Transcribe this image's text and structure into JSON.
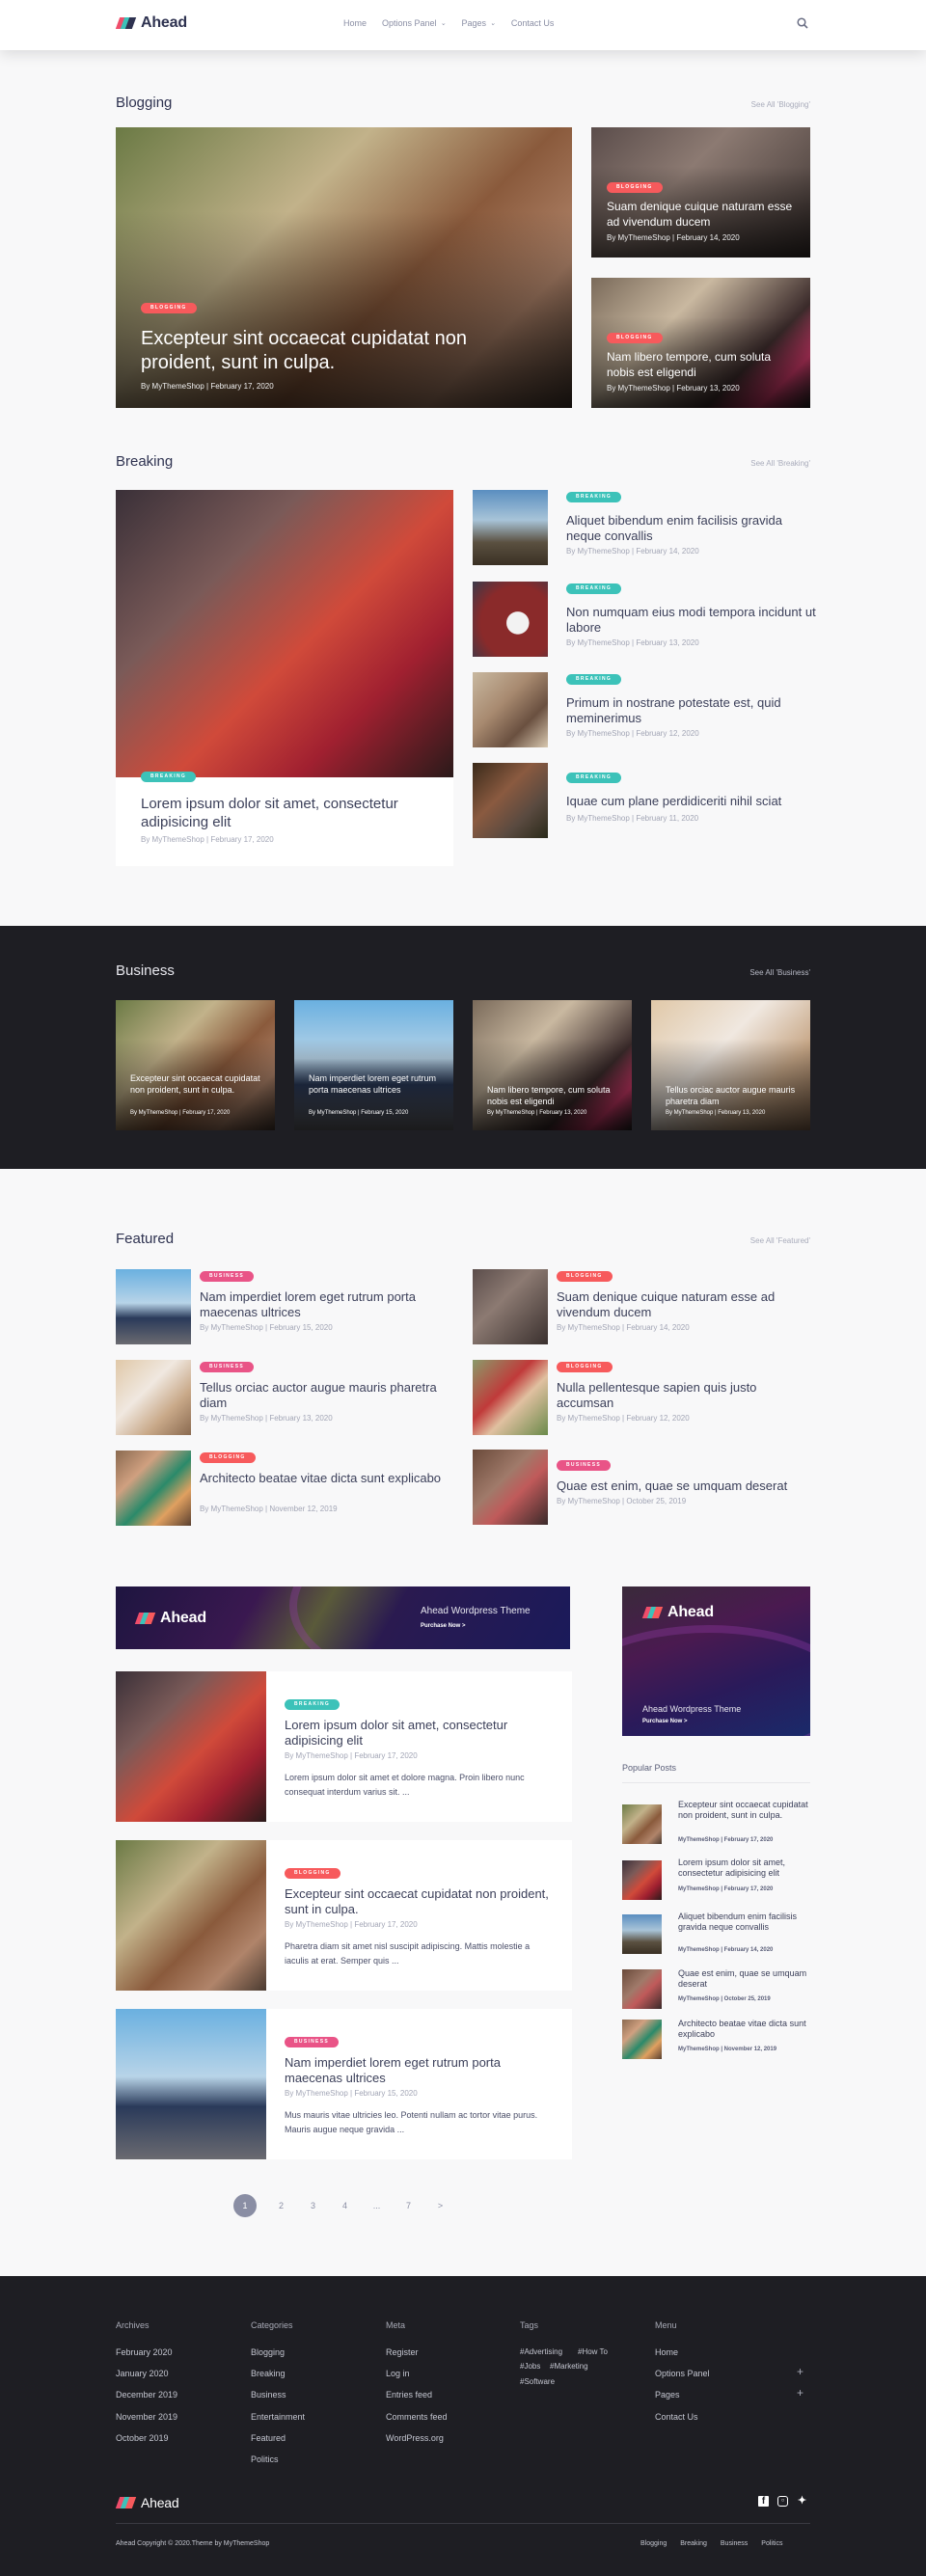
{
  "header": {
    "logo_text": "Ahead",
    "nav": [
      {
        "label": "Home",
        "has_dropdown": false
      },
      {
        "label": "Options Panel",
        "has_dropdown": true
      },
      {
        "label": "Pages",
        "has_dropdown": true
      },
      {
        "label": "Contact Us",
        "has_dropdown": false
      }
    ],
    "search_icon": "search-icon"
  },
  "colors": {
    "blogging": "#f75a5c",
    "breaking": "#3cc2b9",
    "business": "#e95487",
    "dark_bg": "#1e1e23",
    "text": "#2e3250"
  },
  "blogging": {
    "title": "Blogging",
    "see_all": "See All 'Blogging'",
    "main": {
      "tag": "Blogging",
      "title": "Excepteur sint occaecat cupidatat non proident, sunt in culpa.",
      "meta": "By MyThemeShop | February 17, 2020"
    },
    "side": [
      {
        "tag": "Blogging",
        "title": "Suam denique cuique naturam esse ad vivendum ducem",
        "meta": "By MyThemeShop | February 14, 2020"
      },
      {
        "tag": "Blogging",
        "title": "Nam libero tempore, cum soluta nobis est eligendi",
        "meta": "By MyThemeShop | February 13, 2020"
      }
    ]
  },
  "breaking": {
    "title": "Breaking",
    "see_all": "See All 'Breaking'",
    "main": {
      "tag": "Breaking",
      "title": "Lorem ipsum dolor sit amet, consectetur adipisicing elit",
      "meta": "By MyThemeShop | February 17, 2020"
    },
    "list": [
      {
        "tag": "Breaking",
        "title": "Aliquet bibendum enim facilisis gravida neque convallis",
        "meta": "By MyThemeShop | February 14, 2020"
      },
      {
        "tag": "Breaking",
        "title": "Non numquam eius modi tempora incidunt ut labore",
        "meta": "By MyThemeShop | February 13, 2020"
      },
      {
        "tag": "Breaking",
        "title": "Primum in nostrane potestate est, quid meminerimus",
        "meta": "By MyThemeShop | February 12, 2020"
      },
      {
        "tag": "Breaking",
        "title": "Iquae cum plane perdidiceriti nihil sciat",
        "meta": "By MyThemeShop | February 11, 2020"
      }
    ]
  },
  "business": {
    "title": "Business",
    "see_all": "See All 'Business'",
    "cards": [
      {
        "title": "Excepteur sint occaecat cupidatat non proident, sunt in culpa.",
        "meta": "By MyThemeShop | February 17, 2020"
      },
      {
        "title": "Nam imperdiet lorem eget rutrum porta maecenas ultrices",
        "meta": "By MyThemeShop | February 15, 2020"
      },
      {
        "title": "Nam libero tempore, cum soluta nobis est eligendi",
        "meta": "By MyThemeShop | February 13, 2020"
      },
      {
        "title": "Tellus orciac auctor augue mauris pharetra diam",
        "meta": "By MyThemeShop | February 13, 2020"
      }
    ]
  },
  "featured": {
    "title": "Featured",
    "see_all": "See All 'Featured'",
    "left": [
      {
        "tag": "Business",
        "title": "Nam imperdiet lorem eget rutrum porta maecenas ultrices",
        "meta": "By MyThemeShop | February 15, 2020"
      },
      {
        "tag": "Business",
        "title": "Tellus orciac auctor augue mauris pharetra diam",
        "meta": "By MyThemeShop | February 13, 2020"
      },
      {
        "tag": "Blogging",
        "title": "Architecto beatae vitae dicta sunt explicabo",
        "meta": "By MyThemeShop | November 12, 2019"
      }
    ],
    "right": [
      {
        "tag": "Blogging",
        "title": "Suam denique cuique naturam esse ad vivendum ducem",
        "meta": "By MyThemeShop | February 14, 2020"
      },
      {
        "tag": "Blogging",
        "title": "Nulla pellentesque sapien quis justo accumsan",
        "meta": "By MyThemeShop | February 12, 2020"
      },
      {
        "tag": "Business",
        "title": "Quae est enim, quae se umquam deserat",
        "meta": "By MyThemeShop | October 25, 2019"
      }
    ]
  },
  "banner": {
    "logo_text": "Ahead",
    "headline": "Ahead Wordpress Theme",
    "cta": "Purchase Now  >"
  },
  "posts": [
    {
      "tag": "Breaking",
      "title": "Lorem ipsum dolor sit amet, consectetur adipisicing elit",
      "meta": "By MyThemeShop | February 17, 2020",
      "excerpt": "Lorem ipsum dolor sit amet et dolore magna. Proin libero nunc consequat interdum varius sit. ..."
    },
    {
      "tag": "Blogging",
      "title": "Excepteur sint occaecat cupidatat non proident, sunt in culpa.",
      "meta": "By MyThemeShop | February 17, 2020",
      "excerpt": "Pharetra diam sit amet nisl suscipit adipiscing. Mattis molestie a iaculis at erat. Semper quis ..."
    },
    {
      "tag": "Business",
      "title": "Nam imperdiet lorem eget rutrum porta maecenas ultrices",
      "meta": "By MyThemeShop | February 15, 2020",
      "excerpt": "Mus mauris vitae ultricies leo. Potenti nullam ac tortor vitae purus. Mauris augue neque gravida ..."
    }
  ],
  "pagination": {
    "current": "1",
    "pages": [
      "2",
      "3",
      "4",
      "...",
      "7"
    ],
    "next": ">"
  },
  "sidebar": {
    "ad": {
      "logo_text": "Ahead",
      "headline": "Ahead Wordpress Theme",
      "cta": "Purchase Now  >"
    },
    "popular_title": "Popular Posts",
    "popular": [
      {
        "title": "Excepteur sint occaecat cupidatat non proident, sunt in culpa.",
        "meta": "MyThemeShop | February 17, 2020"
      },
      {
        "title": "Lorem ipsum dolor sit amet, consectetur adipisicing elit",
        "meta": "MyThemeShop | February 17, 2020"
      },
      {
        "title": "Aliquet bibendum enim facilisis gravida neque convallis",
        "meta": "MyThemeShop | February 14, 2020"
      },
      {
        "title": "Quae est enim, quae se umquam deserat",
        "meta": "MyThemeShop | October 25, 2019"
      },
      {
        "title": "Architecto beatae vitae dicta sunt explicabo",
        "meta": "MyThemeShop | November 12, 2019"
      }
    ]
  },
  "footer": {
    "archives": {
      "title": "Archives",
      "items": [
        "February 2020",
        "January 2020",
        "December 2019",
        "November 2019",
        "October 2019"
      ]
    },
    "categories": {
      "title": "Categories",
      "items": [
        "Blogging",
        "Breaking",
        "Business",
        "Entertainment",
        "Featured",
        "Politics"
      ]
    },
    "meta": {
      "title": "Meta",
      "items": [
        "Register",
        "Log in",
        "Entries feed",
        "Comments feed",
        "WordPress.org"
      ]
    },
    "tags": {
      "title": "Tags",
      "items": [
        "#Advertising",
        "#How To",
        "#Jobs",
        "#Marketing",
        "#Software"
      ]
    },
    "menu": {
      "title": "Menu",
      "items": [
        "Home",
        "Options Panel",
        "Pages",
        "Contact Us"
      ]
    },
    "logo_text": "Ahead",
    "social": [
      "facebook-icon",
      "instagram-icon",
      "twitter-icon"
    ],
    "copyright": "Ahead Copyright © 2020.Theme by MyThemeShop",
    "bottom_links": [
      "Blogging",
      "Breaking",
      "Business",
      "Politics"
    ]
  }
}
